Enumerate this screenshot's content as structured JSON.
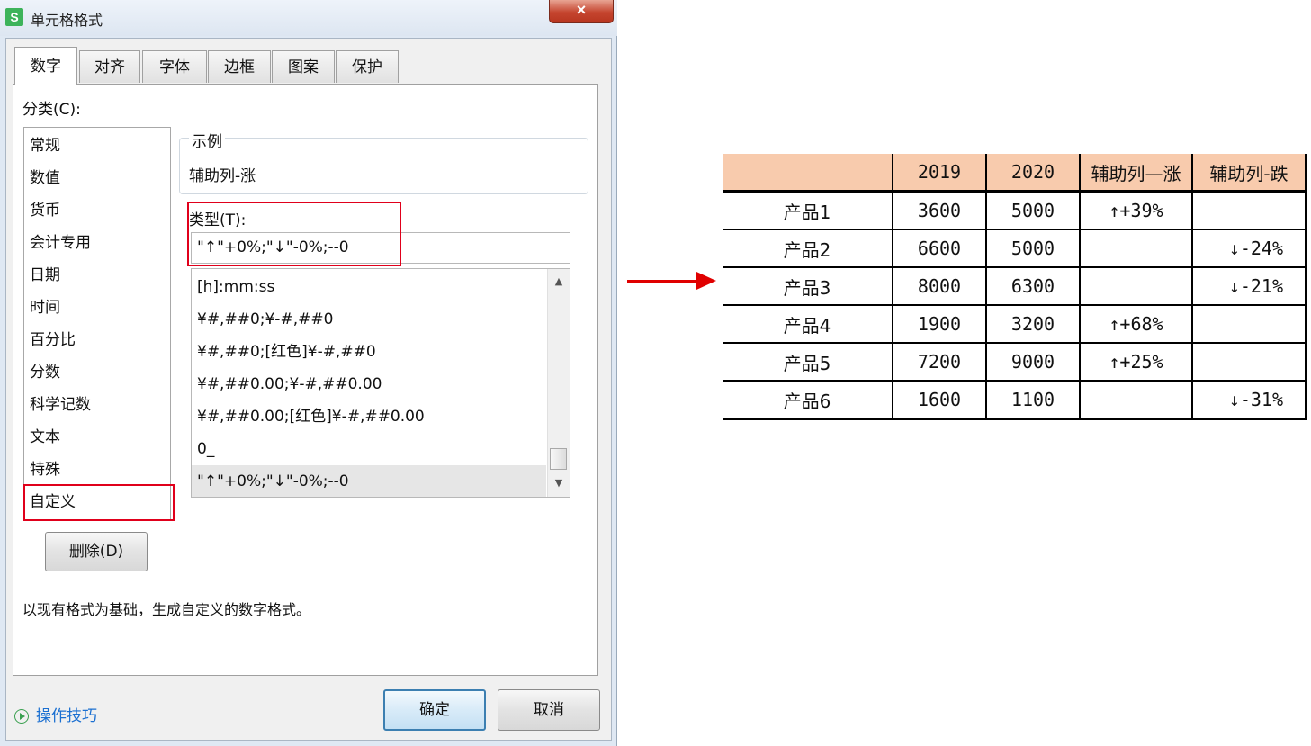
{
  "dialog": {
    "title": "单元格格式",
    "app_icon": "S",
    "close_glyph": "×",
    "tabs": [
      "数字",
      "对齐",
      "字体",
      "边框",
      "图案",
      "保护"
    ],
    "active_tab": "数字",
    "category_label": "分类(C):",
    "categories": [
      "常规",
      "数值",
      "货币",
      "会计专用",
      "日期",
      "时间",
      "百分比",
      "分数",
      "科学记数",
      "文本",
      "特殊",
      "自定义"
    ],
    "selected_category": "自定义",
    "sample_label": "示例",
    "sample_value": "辅助列-涨",
    "type_label": "类型(T):",
    "type_value": "\"↑\"+0%;\"↓\"-0%;--0",
    "formats": [
      "[h]:mm:ss",
      "¥#,##0;¥-#,##0",
      "¥#,##0;[红色]¥-#,##0",
      "¥#,##0.00;¥-#,##0.00",
      "¥#,##0.00;[红色]¥-#,##0.00",
      "0_",
      "\"↑\"+0%;\"↓\"-0%;--0"
    ],
    "delete_button": "删除(D)",
    "description": "以现有格式为基础，生成自定义的数字格式。",
    "help_link": "操作技巧",
    "ok_button": "确定",
    "cancel_button": "取消"
  },
  "sheet": {
    "headers": [
      "",
      "2019",
      "2020",
      "辅助列—涨",
      "辅助列-跌"
    ],
    "rows": [
      [
        "产品1",
        "3600",
        "5000",
        "↑+39%",
        ""
      ],
      [
        "产品2",
        "6600",
        "5000",
        "",
        "↓-24%"
      ],
      [
        "产品3",
        "8000",
        "6300",
        "",
        "↓-21%"
      ],
      [
        "产品4",
        "1900",
        "3200",
        "↑+68%",
        ""
      ],
      [
        "产品5",
        "7200",
        "9000",
        "↑+25%",
        ""
      ],
      [
        "产品6",
        "1600",
        "1100",
        "",
        "↓-31%"
      ]
    ],
    "header_color": "#f8cbad"
  },
  "colors": {
    "highlight_red": "#e00000",
    "link_blue": "#1a6fd1"
  }
}
